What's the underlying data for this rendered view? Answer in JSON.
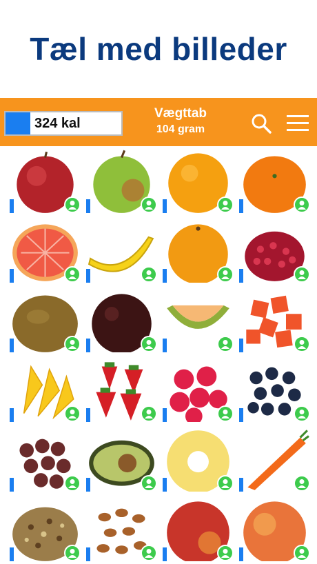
{
  "app": {
    "title": "Tæl med billeder"
  },
  "toolbar": {
    "calories_value": "324 kal",
    "goal_label": "Vægttab",
    "goal_amount": "104 gram",
    "accent_color": "#f7941d",
    "title_color": "#0b3a7e"
  },
  "icons": {
    "search": "search-icon",
    "menu": "hamburger-menu-icon",
    "portion": "person-portion-icon"
  },
  "foods": [
    {
      "name": "red-apple",
      "level": 0.2
    },
    {
      "name": "green-apple",
      "level": 0.2
    },
    {
      "name": "orange",
      "level": 0.2
    },
    {
      "name": "mandarin",
      "level": 0.2
    },
    {
      "name": "grapefruit-half",
      "level": 0.2
    },
    {
      "name": "banana",
      "level": 0.2
    },
    {
      "name": "orange-2",
      "level": 0.2
    },
    {
      "name": "pomegranate-seeds",
      "level": 0.2
    },
    {
      "name": "kiwi",
      "level": 0.2
    },
    {
      "name": "plum",
      "level": 0.2
    },
    {
      "name": "melon-slice",
      "level": 0.2
    },
    {
      "name": "papaya-cubes",
      "level": 0.2
    },
    {
      "name": "mango-slices",
      "level": 0.2
    },
    {
      "name": "strawberries",
      "level": 0.2
    },
    {
      "name": "raspberries",
      "level": 0.2
    },
    {
      "name": "blueberries",
      "level": 0.2
    },
    {
      "name": "grapes",
      "level": 0.2
    },
    {
      "name": "avocado-half",
      "level": 0.2
    },
    {
      "name": "pineapple-ring",
      "level": 0.2
    },
    {
      "name": "carrot",
      "level": 0.2
    },
    {
      "name": "muesli",
      "level": 0.2
    },
    {
      "name": "almonds",
      "level": 0.2
    },
    {
      "name": "nectarine",
      "level": 0.2
    },
    {
      "name": "peach",
      "level": 0.2
    }
  ]
}
